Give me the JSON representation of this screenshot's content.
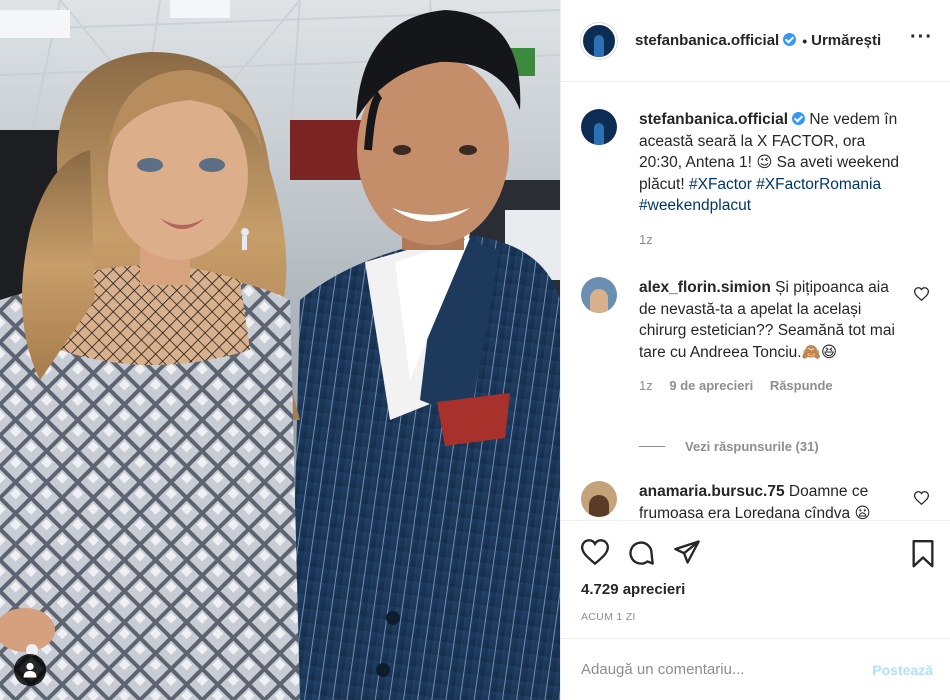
{
  "header": {
    "username": "stefanbanica.official",
    "separator": "•",
    "follow_label": "Urmărești",
    "more_label": "···"
  },
  "caption": {
    "username": "stefanbanica.official",
    "text": "Ne vedem în această seară la X FACTOR, ora 20:30, Antena 1! 😉 Sa aveti weekend plăcut!",
    "hashtags": [
      "#XFactor",
      "#XFactorRomania",
      "#weekendplacut"
    ],
    "time": "1z"
  },
  "comments": [
    {
      "username": "alex_florin.simion",
      "text": "Și pițipoanca aia de nevastă-ta a apelat la același chirurg estetician?? Seamănă tot mai tare cu Andreea Tonciu.🙈😆",
      "time": "1z",
      "likes": "9 de aprecieri",
      "reply_label": "Răspunde"
    },
    {
      "username": "anamaria.bursuc.75",
      "text": "Doamne ce frumoasa era Loredana cîndva 😦",
      "time": "",
      "likes": "",
      "reply_label": ""
    }
  ],
  "view_replies": "Vezi răspunsurile (31)",
  "likes_count": "4.729 aprecieri",
  "timestamp": "ACUM 1 ZI",
  "add_comment": {
    "placeholder": "Adaugă un comentariu...",
    "post_label": "Postează"
  },
  "icons": {
    "like": "heart-icon",
    "comment": "comment-bubble-icon",
    "share": "paper-plane-icon",
    "save": "bookmark-icon",
    "tag": "user-tag-icon",
    "verified": "verified-badge-icon"
  },
  "colors": {
    "verified_blue": "#3897f0",
    "hashtag_link": "#00376b",
    "muted_text": "#8e8e8e",
    "post_button_disabled": "#b2dffc"
  }
}
